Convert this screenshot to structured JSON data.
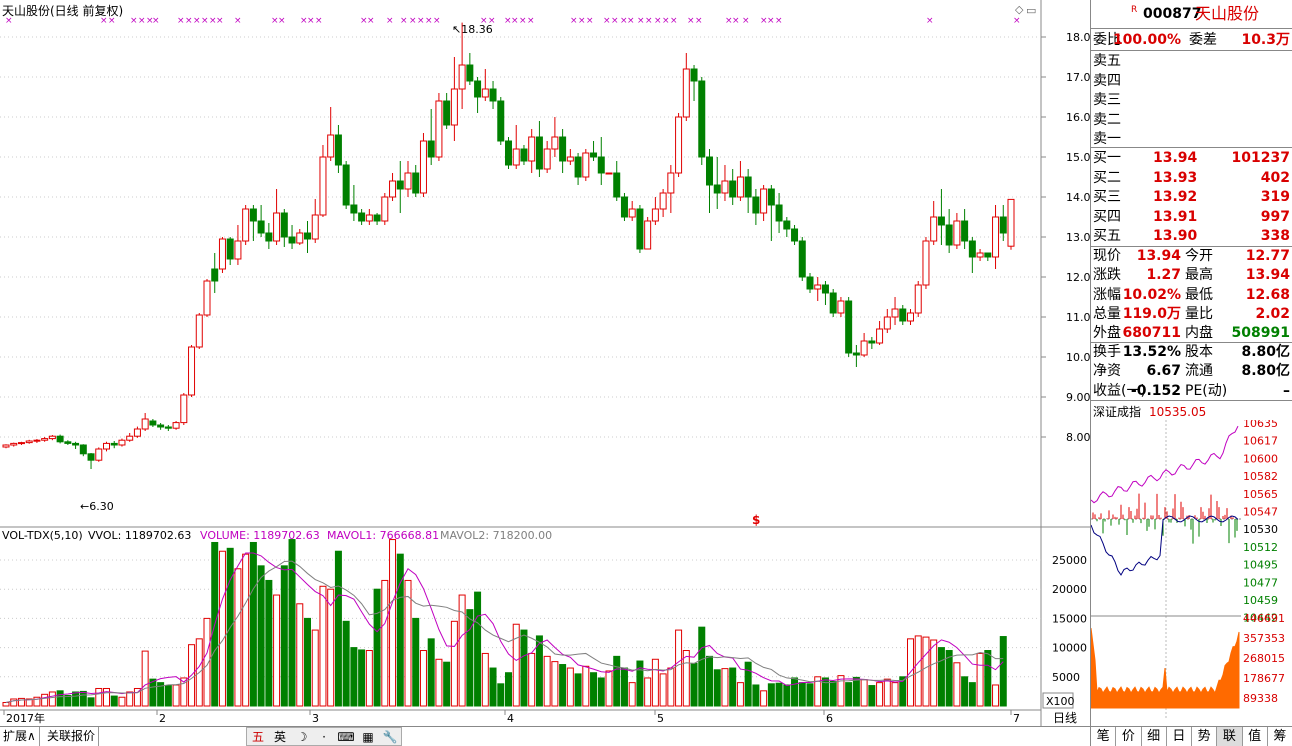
{
  "stock": {
    "code": "000877",
    "name": "天山股份",
    "r_mark": "R"
  },
  "chart_title": "天山股份(日线 前复权)",
  "axis_y_labels": [
    "18.00",
    "17.00",
    "16.00",
    "15.00",
    "14.00",
    "13.00",
    "12.00",
    "11.00",
    "10.00",
    "9.00",
    "8.00"
  ],
  "high_annotation": "18.36",
  "low_annotation": "6.30",
  "dollar_mark": "$",
  "vol_legend": {
    "name": "VOL-TDX(5,10)",
    "vvol": "VVOL: 1189702.63",
    "volume": "VOLUME: 1189702.63",
    "mavol1": "MAVOL1: 766668.81",
    "mavol2": "MAVOL2: 718200.00"
  },
  "vol_axis_labels": [
    "25000",
    "20000",
    "15000",
    "10000",
    "5000"
  ],
  "vol_unit": "X100",
  "x_labels": [
    "2017年",
    "2",
    "3",
    "4",
    "5",
    "6",
    "7"
  ],
  "period_label": "日线",
  "bottom_tabs": [
    "扩展∧",
    "关联报价"
  ],
  "toolbar_glyphs": [
    "五",
    "英",
    "☽",
    "·",
    "⌨",
    "▦",
    "🔧"
  ],
  "quote": {
    "weibi_label": "委比",
    "weibi": "100.00%",
    "weicha_label": "委差",
    "weicha": "10.3万",
    "sell": [
      {
        "label": "卖五"
      },
      {
        "label": "卖四"
      },
      {
        "label": "卖三"
      },
      {
        "label": "卖二"
      },
      {
        "label": "卖一"
      }
    ],
    "buy": [
      {
        "label": "买一",
        "price": "13.94",
        "vol": "101237"
      },
      {
        "label": "买二",
        "price": "13.93",
        "vol": "402"
      },
      {
        "label": "买三",
        "price": "13.92",
        "vol": "319"
      },
      {
        "label": "买四",
        "price": "13.91",
        "vol": "997"
      },
      {
        "label": "买五",
        "price": "13.90",
        "vol": "338"
      }
    ],
    "rows": [
      {
        "l1": "现价",
        "v1": "13.94",
        "c1": "red",
        "l2": "今开",
        "v2": "12.77",
        "c2": "red"
      },
      {
        "l1": "涨跌",
        "v1": "1.27",
        "c1": "red",
        "l2": "最高",
        "v2": "13.94",
        "c2": "red"
      },
      {
        "l1": "涨幅",
        "v1": "10.02%",
        "c1": "red",
        "l2": "最低",
        "v2": "12.68",
        "c2": "red"
      },
      {
        "l1": "总量",
        "v1": "119.0万",
        "c1": "red",
        "l2": "量比",
        "v2": "2.02",
        "c2": "red"
      },
      {
        "l1": "外盘",
        "v1": "680711",
        "c1": "red",
        "l2": "内盘",
        "v2": "508991",
        "c2": "green"
      }
    ],
    "rows2": [
      {
        "l1": "换手",
        "v1": "13.52%",
        "c1": "black",
        "l2": "股本",
        "v2": "8.80亿",
        "c2": "black"
      },
      {
        "l1": "净资",
        "v1": "6.67",
        "c1": "black",
        "l2": "流通",
        "v2": "8.80亿",
        "c2": "black"
      },
      {
        "l1": "收益(一)",
        "v1": "-0.152",
        "c1": "black",
        "l2": "PE(动)",
        "v2": "–",
        "c2": "black"
      }
    ],
    "index_name": "深证成指",
    "index_value": "10535.05",
    "index_axis": [
      "10635",
      "10617",
      "10600",
      "10582",
      "10565",
      "10547",
      "10530",
      "10512",
      "10495",
      "10477",
      "10459",
      "10442"
    ],
    "vol_axis": [
      "446691",
      "357353",
      "268015",
      "178677",
      "89338"
    ],
    "tabs": [
      "笔",
      "价",
      "细",
      "日",
      "势",
      "联",
      "值",
      "筹"
    ],
    "active_tab": "联"
  },
  "colors": {
    "up": "#e00000",
    "down": "#008000",
    "ma1": "#c000c0",
    "ma2": "#808080"
  },
  "chart_data": {
    "type": "candlestick",
    "title": "天山股份(日线 前复权)",
    "ylim": [
      7.8,
      18.5
    ],
    "candles": [
      [
        7.75,
        7.8,
        7.72,
        7.82,
        0
      ],
      [
        7.8,
        7.84,
        7.76,
        7.86,
        0
      ],
      [
        7.84,
        7.86,
        7.8,
        7.88,
        0
      ],
      [
        7.86,
        7.9,
        7.83,
        7.93,
        0
      ],
      [
        7.9,
        7.92,
        7.85,
        7.95,
        0
      ],
      [
        7.92,
        7.96,
        7.88,
        8.0,
        0
      ],
      [
        7.96,
        8.02,
        7.92,
        8.05,
        0
      ],
      [
        8.02,
        7.88,
        7.84,
        8.06,
        1
      ],
      [
        7.88,
        7.84,
        7.8,
        7.92,
        1
      ],
      [
        7.84,
        7.8,
        7.7,
        7.88,
        1
      ],
      [
        7.8,
        7.58,
        7.52,
        7.82,
        1
      ],
      [
        7.58,
        7.42,
        7.2,
        7.6,
        1
      ],
      [
        7.42,
        7.7,
        7.38,
        7.74,
        0
      ],
      [
        7.7,
        7.84,
        7.64,
        7.88,
        0
      ],
      [
        7.84,
        7.8,
        7.72,
        7.9,
        1
      ],
      [
        7.8,
        7.92,
        7.76,
        7.96,
        0
      ],
      [
        7.92,
        8.02,
        7.88,
        8.1,
        0
      ],
      [
        8.02,
        8.2,
        7.98,
        8.26,
        0
      ],
      [
        8.2,
        8.45,
        8.15,
        8.6,
        0
      ],
      [
        8.4,
        8.3,
        8.25,
        8.45,
        1
      ],
      [
        8.3,
        8.25,
        8.18,
        8.35,
        1
      ],
      [
        8.25,
        8.22,
        8.15,
        8.3,
        1
      ],
      [
        8.22,
        8.36,
        8.18,
        8.4,
        0
      ],
      [
        8.36,
        9.05,
        8.3,
        9.1,
        0
      ],
      [
        9.05,
        10.25,
        9.0,
        10.3,
        0
      ],
      [
        10.25,
        11.05,
        10.2,
        11.1,
        0
      ],
      [
        11.05,
        11.9,
        11.0,
        11.95,
        0
      ],
      [
        11.9,
        12.2,
        11.6,
        12.6,
        1
      ],
      [
        12.2,
        12.95,
        12.1,
        13.0,
        0
      ],
      [
        12.95,
        12.45,
        12.3,
        13.0,
        1
      ],
      [
        12.45,
        12.9,
        12.3,
        13.3,
        0
      ],
      [
        12.9,
        13.7,
        12.8,
        13.8,
        0
      ],
      [
        13.7,
        13.4,
        12.9,
        13.8,
        1
      ],
      [
        13.4,
        13.1,
        13.0,
        13.8,
        1
      ],
      [
        13.1,
        12.9,
        12.7,
        13.35,
        1
      ],
      [
        12.9,
        13.6,
        12.8,
        14.2,
        0
      ],
      [
        13.6,
        13.0,
        12.75,
        13.7,
        1
      ],
      [
        13.0,
        12.85,
        12.7,
        13.3,
        1
      ],
      [
        12.85,
        13.1,
        12.8,
        13.2,
        0
      ],
      [
        13.1,
        12.95,
        12.6,
        13.4,
        1
      ],
      [
        12.95,
        13.55,
        12.85,
        13.95,
        0
      ],
      [
        13.55,
        15.0,
        13.5,
        15.3,
        0
      ],
      [
        15.0,
        15.55,
        14.9,
        16.25,
        0
      ],
      [
        15.55,
        14.8,
        14.6,
        15.8,
        1
      ],
      [
        14.8,
        13.8,
        13.7,
        14.9,
        1
      ],
      [
        13.8,
        13.6,
        13.4,
        14.3,
        1
      ],
      [
        13.6,
        13.4,
        13.3,
        13.7,
        1
      ],
      [
        13.4,
        13.55,
        13.3,
        13.7,
        0
      ],
      [
        13.55,
        13.4,
        13.3,
        13.6,
        1
      ],
      [
        13.4,
        14.0,
        13.3,
        14.1,
        0
      ],
      [
        14.0,
        14.4,
        13.9,
        14.6,
        0
      ],
      [
        14.4,
        14.2,
        13.6,
        14.9,
        1
      ],
      [
        14.2,
        14.6,
        14.0,
        14.9,
        0
      ],
      [
        14.6,
        14.1,
        14.0,
        14.8,
        1
      ],
      [
        14.1,
        15.4,
        14.0,
        15.6,
        0
      ],
      [
        15.4,
        15.0,
        14.8,
        16.2,
        1
      ],
      [
        15.0,
        16.4,
        14.9,
        16.6,
        0
      ],
      [
        16.4,
        15.8,
        15.7,
        16.6,
        1
      ],
      [
        15.8,
        16.7,
        15.4,
        17.5,
        0
      ],
      [
        16.7,
        17.3,
        16.2,
        18.36,
        0
      ],
      [
        17.3,
        16.9,
        16.8,
        17.6,
        1
      ],
      [
        16.9,
        16.5,
        16.1,
        17.0,
        1
      ],
      [
        16.5,
        16.7,
        16.4,
        17.2,
        0
      ],
      [
        16.7,
        16.4,
        16.2,
        16.9,
        1
      ],
      [
        16.4,
        15.4,
        15.3,
        16.5,
        1
      ],
      [
        15.4,
        14.8,
        14.7,
        15.5,
        1
      ],
      [
        14.8,
        15.2,
        14.7,
        15.8,
        0
      ],
      [
        15.2,
        14.9,
        14.8,
        15.3,
        1
      ],
      [
        14.9,
        15.5,
        14.6,
        15.7,
        0
      ],
      [
        15.5,
        14.7,
        14.5,
        15.9,
        1
      ],
      [
        14.7,
        15.2,
        14.6,
        15.4,
        0
      ],
      [
        15.2,
        15.5,
        15.0,
        16.0,
        0
      ],
      [
        15.5,
        14.9,
        14.6,
        15.7,
        1
      ],
      [
        14.9,
        15.0,
        14.8,
        15.2,
        0
      ],
      [
        15.0,
        14.5,
        14.3,
        15.1,
        1
      ],
      [
        14.5,
        15.1,
        14.4,
        15.2,
        0
      ],
      [
        15.1,
        15.0,
        14.9,
        15.4,
        1
      ],
      [
        15.0,
        14.6,
        14.3,
        15.5,
        1
      ],
      [
        14.6,
        14.6,
        14.6,
        14.6,
        0
      ],
      [
        14.6,
        14.0,
        13.9,
        14.9,
        1
      ],
      [
        14.0,
        13.5,
        13.4,
        14.1,
        1
      ],
      [
        13.5,
        13.7,
        13.4,
        13.9,
        0
      ],
      [
        13.7,
        12.7,
        12.6,
        13.8,
        1
      ],
      [
        12.7,
        13.4,
        12.7,
        13.5,
        0
      ],
      [
        13.4,
        13.7,
        13.3,
        14.0,
        0
      ],
      [
        13.7,
        14.1,
        13.5,
        14.2,
        0
      ],
      [
        14.1,
        14.6,
        13.6,
        14.8,
        0
      ],
      [
        14.6,
        16.0,
        14.5,
        16.1,
        0
      ],
      [
        16.0,
        17.2,
        15.9,
        17.6,
        0
      ],
      [
        17.2,
        16.9,
        16.4,
        17.3,
        1
      ],
      [
        16.9,
        15.0,
        14.8,
        17.0,
        1
      ],
      [
        15.0,
        14.3,
        13.6,
        15.2,
        1
      ],
      [
        14.3,
        14.1,
        13.7,
        15.0,
        1
      ],
      [
        14.1,
        14.4,
        13.9,
        14.8,
        0
      ],
      [
        14.4,
        14.0,
        13.8,
        14.7,
        1
      ],
      [
        14.0,
        14.5,
        13.9,
        14.9,
        0
      ],
      [
        14.5,
        14.0,
        13.6,
        14.7,
        1
      ],
      [
        14.0,
        13.6,
        13.3,
        14.2,
        1
      ],
      [
        13.6,
        14.2,
        13.4,
        14.3,
        0
      ],
      [
        14.2,
        13.8,
        12.9,
        14.3,
        1
      ],
      [
        13.8,
        13.4,
        13.1,
        14.1,
        1
      ],
      [
        13.4,
        13.2,
        13.0,
        13.5,
        1
      ],
      [
        13.2,
        12.9,
        12.8,
        13.3,
        1
      ],
      [
        12.9,
        12.0,
        11.9,
        13.0,
        1
      ],
      [
        12.0,
        11.7,
        11.6,
        12.1,
        1
      ],
      [
        11.7,
        11.8,
        11.4,
        12.0,
        0
      ],
      [
        11.8,
        11.6,
        11.3,
        11.9,
        1
      ],
      [
        11.6,
        11.1,
        11.0,
        11.7,
        1
      ],
      [
        11.1,
        11.4,
        11.0,
        11.5,
        0
      ],
      [
        11.4,
        10.1,
        10.0,
        11.5,
        1
      ],
      [
        10.1,
        10.05,
        9.75,
        10.3,
        1
      ],
      [
        10.05,
        10.4,
        10.0,
        10.6,
        0
      ],
      [
        10.4,
        10.35,
        10.2,
        10.5,
        1
      ],
      [
        10.35,
        10.7,
        10.3,
        10.9,
        0
      ],
      [
        10.7,
        11.0,
        10.6,
        11.2,
        0
      ],
      [
        11.0,
        11.2,
        10.8,
        11.5,
        0
      ],
      [
        11.2,
        10.9,
        10.8,
        11.3,
        1
      ],
      [
        10.9,
        11.1,
        10.8,
        11.2,
        0
      ],
      [
        11.1,
        11.8,
        11.0,
        11.9,
        0
      ],
      [
        11.8,
        12.9,
        11.7,
        13.0,
        0
      ],
      [
        12.9,
        13.5,
        12.8,
        13.9,
        0
      ],
      [
        13.5,
        13.3,
        12.8,
        14.2,
        1
      ],
      [
        13.3,
        12.8,
        12.6,
        13.7,
        1
      ],
      [
        12.8,
        13.4,
        12.7,
        13.6,
        0
      ],
      [
        13.4,
        12.9,
        12.7,
        13.7,
        1
      ],
      [
        12.9,
        12.5,
        12.1,
        13.0,
        1
      ],
      [
        12.5,
        12.6,
        12.4,
        12.7,
        0
      ],
      [
        12.6,
        12.5,
        12.4,
        12.6,
        1
      ],
      [
        12.5,
        13.5,
        12.2,
        13.8,
        0
      ],
      [
        13.5,
        13.1,
        12.9,
        13.8,
        1
      ],
      [
        12.77,
        13.94,
        12.68,
        13.94,
        0
      ]
    ],
    "volumes": [
      600,
      1200,
      1300,
      1200,
      1500,
      2000,
      2400,
      2600,
      1800,
      2400,
      2500,
      1400,
      3000,
      3000,
      1700,
      1500,
      2400,
      3000,
      9400,
      4600,
      4000,
      3500,
      3600,
      4800,
      10500,
      11500,
      15000,
      28000,
      26500,
      27000,
      23500,
      26000,
      28000,
      24000,
      21500,
      19000,
      24000,
      28500,
      17500,
      15000,
      13000,
      20500,
      20000,
      26500,
      14500,
      10000,
      9600,
      9500,
      20000,
      21500,
      28500,
      26000,
      21500,
      15000,
      9500,
      11500,
      8000,
      7500,
      14500,
      19000,
      16500,
      19500,
      9000,
      6500,
      3800,
      5700,
      14000,
      13000,
      9000,
      12000,
      8500,
      7600,
      7100,
      6500,
      5500,
      6800,
      5700,
      4800,
      6000,
      8500,
      6500,
      4000,
      7700,
      4800,
      8000,
      5500,
      6500,
      13000,
      9500,
      7300,
      13500,
      8500,
      6200,
      6400,
      6500,
      4000,
      7500,
      3600,
      2600,
      3800,
      3900,
      3600,
      4800,
      4000,
      3800,
      5000,
      4800,
      4200,
      5200,
      4000,
      4900,
      4500,
      3500,
      4000,
      4600,
      4000,
      5000,
      11500,
      12000,
      11800,
      11300,
      10000,
      9500,
      7400,
      5000,
      4000,
      9000,
      9500,
      3600,
      11893
    ],
    "volume_down": [
      0,
      0,
      0,
      0,
      0,
      0,
      0,
      1,
      1,
      1,
      1,
      1,
      0,
      0,
      1,
      0,
      0,
      0,
      0,
      1,
      1,
      1,
      0,
      0,
      0,
      0,
      0,
      1,
      0,
      1,
      0,
      0,
      1,
      1,
      1,
      0,
      1,
      1,
      0,
      1,
      0,
      0,
      0,
      1,
      1,
      1,
      1,
      0,
      1,
      0,
      0,
      1,
      0,
      1,
      0,
      1,
      0,
      1,
      0,
      0,
      1,
      1,
      0,
      1,
      1,
      1,
      0,
      1,
      0,
      1,
      0,
      0,
      1,
      0,
      1,
      0,
      1,
      1,
      0,
      1,
      1,
      0,
      1,
      0,
      0,
      0,
      0,
      0,
      0,
      1,
      1,
      1,
      1,
      0,
      1,
      0,
      1,
      1,
      0,
      1,
      1,
      1,
      1,
      1,
      1,
      0,
      1,
      1,
      0,
      1,
      1,
      0,
      1,
      0,
      0,
      0,
      1,
      0,
      0,
      0,
      0,
      1,
      1,
      0,
      1,
      1,
      0,
      1,
      0,
      1,
      0
    ]
  }
}
